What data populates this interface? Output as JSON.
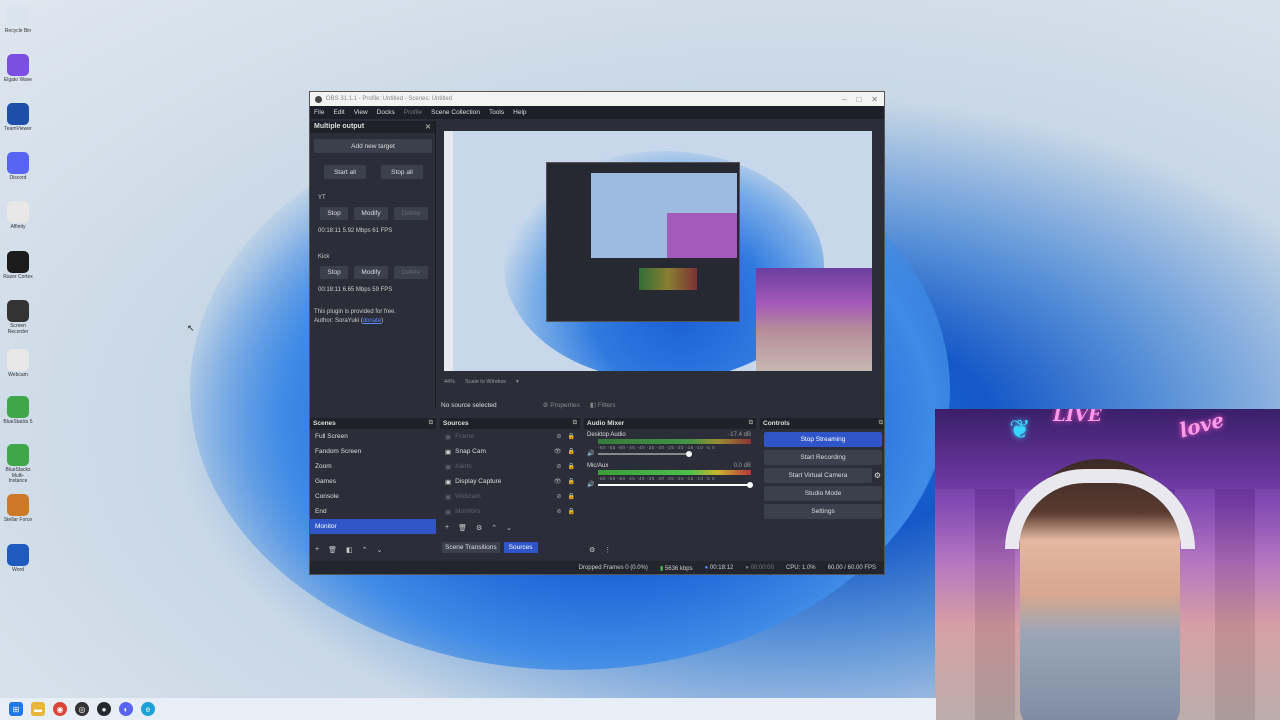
{
  "desktop_icons": [
    {
      "label": "Recycle Bin",
      "icon": "recycle-bin-icon",
      "color": "#d9e4ef"
    },
    {
      "label": "Elgato Wave",
      "icon": "wave-icon",
      "color": "#7b4fe0"
    },
    {
      "label": "TeamViewer",
      "icon": "teamviewer-icon",
      "color": "#1c4fa8"
    },
    {
      "label": "Discord",
      "icon": "discord-icon",
      "color": "#5865f2"
    },
    {
      "label": "Affinity",
      "icon": "affinity-icon",
      "color": "#e8e8e8"
    },
    {
      "label": "Razer Cortex",
      "icon": "razer-icon",
      "color": "#1b1b1b"
    },
    {
      "label": "Screen Recorder",
      "icon": "recorder-icon",
      "color": "#333333"
    },
    {
      "label": "Webcam",
      "icon": "webcam-icon",
      "color": "#e8e8e8"
    },
    {
      "label": "BlueStacks 5",
      "icon": "bluestacks-icon",
      "color": "#3fa64a"
    },
    {
      "label": "BlueStacks Multi-Instance",
      "icon": "bluestacks-multi-icon",
      "color": "#3fa64a"
    },
    {
      "label": "Stellar Force",
      "icon": "game-icon",
      "color": "#cc7a2a"
    },
    {
      "label": "Word",
      "icon": "word-icon",
      "color": "#1f5bbf"
    }
  ],
  "window": {
    "title": "OBS 31.1.1 - Profile: Untitled - Scenes: Untitled",
    "menu": [
      "File",
      "Edit",
      "View",
      "Docks",
      "Profile",
      "Scene Collection",
      "Tools",
      "Help"
    ]
  },
  "multiple_output": {
    "title": "Multiple output",
    "add_target": "Add new target",
    "start_all": "Start all",
    "stop_all": "Stop all",
    "targets": [
      {
        "name": "YT",
        "stop": "Stop",
        "modify": "Modify",
        "delete": "Delete",
        "stats": "00:18:11  5.92 Mbps  61 FPS"
      },
      {
        "name": "Kick",
        "stop": "Stop",
        "modify": "Modify",
        "delete": "Delete",
        "stats": "00:18:11  6.65 Mbps  59 FPS"
      }
    ],
    "footer_line1": "This plugin is provided for free.",
    "footer_line2": "Author: SoraYuki (",
    "footer_link": "donate",
    "footer_end": ")"
  },
  "preview": {
    "zoom": "44%",
    "scale": "Scale to Window"
  },
  "source_bar": {
    "text": "No source selected",
    "properties": "Properties",
    "filters": "Filters"
  },
  "scenes": {
    "title": "Scenes",
    "items": [
      "Full Screen",
      "Fandom Screen",
      "Zoom",
      "Games",
      "Console",
      "End",
      "Monitor"
    ],
    "selected_index": 6
  },
  "sources": {
    "title": "Sources",
    "items": [
      {
        "label": "Frame",
        "visible": false
      },
      {
        "label": "Snap Cam",
        "visible": true
      },
      {
        "label": "Alerts",
        "visible": false
      },
      {
        "label": "Display Capture",
        "visible": true
      },
      {
        "label": "Webcam",
        "visible": false
      },
      {
        "label": "Monitors",
        "visible": false
      }
    ],
    "tab_transitions": "Scene Transitions",
    "tab_sources": "Sources"
  },
  "audio_mixer": {
    "title": "Audio Mixer",
    "channels": [
      {
        "name": "Desktop Audio",
        "db": "-17.4 dB"
      },
      {
        "name": "Mic/Aux",
        "db": "0.0 dB"
      }
    ],
    "ticks": "-60 -55 -50 -45 -40 -35 -30 -25 -20 -15 -10 -5 0"
  },
  "controls": {
    "title": "Controls",
    "stop_streaming": "Stop Streaming",
    "start_recording": "Start Recording",
    "start_virtual_camera": "Start Virtual Camera",
    "studio_mode": "Studio Mode",
    "settings": "Settings"
  },
  "status": {
    "dropped": "Dropped Frames 0 (0.0%)",
    "bitrate": "5636 kbps",
    "stream_time": "00:18:12",
    "rec_time": "00:00:00",
    "cpu": "CPU: 1.0%",
    "fps": "60.00 / 60.00 FPS"
  },
  "webcam_overlay": {
    "sign_left": "LIVE",
    "sign_right": "love"
  },
  "taskbar_icons": [
    "windows-start-icon",
    "file-explorer-icon",
    "chrome-icon",
    "obs-icon",
    "github-icon",
    "discord-icon",
    "edge-icon"
  ],
  "colors": {
    "obs_accent": "#2f55c8",
    "obs_bg": "#2b2e38"
  }
}
